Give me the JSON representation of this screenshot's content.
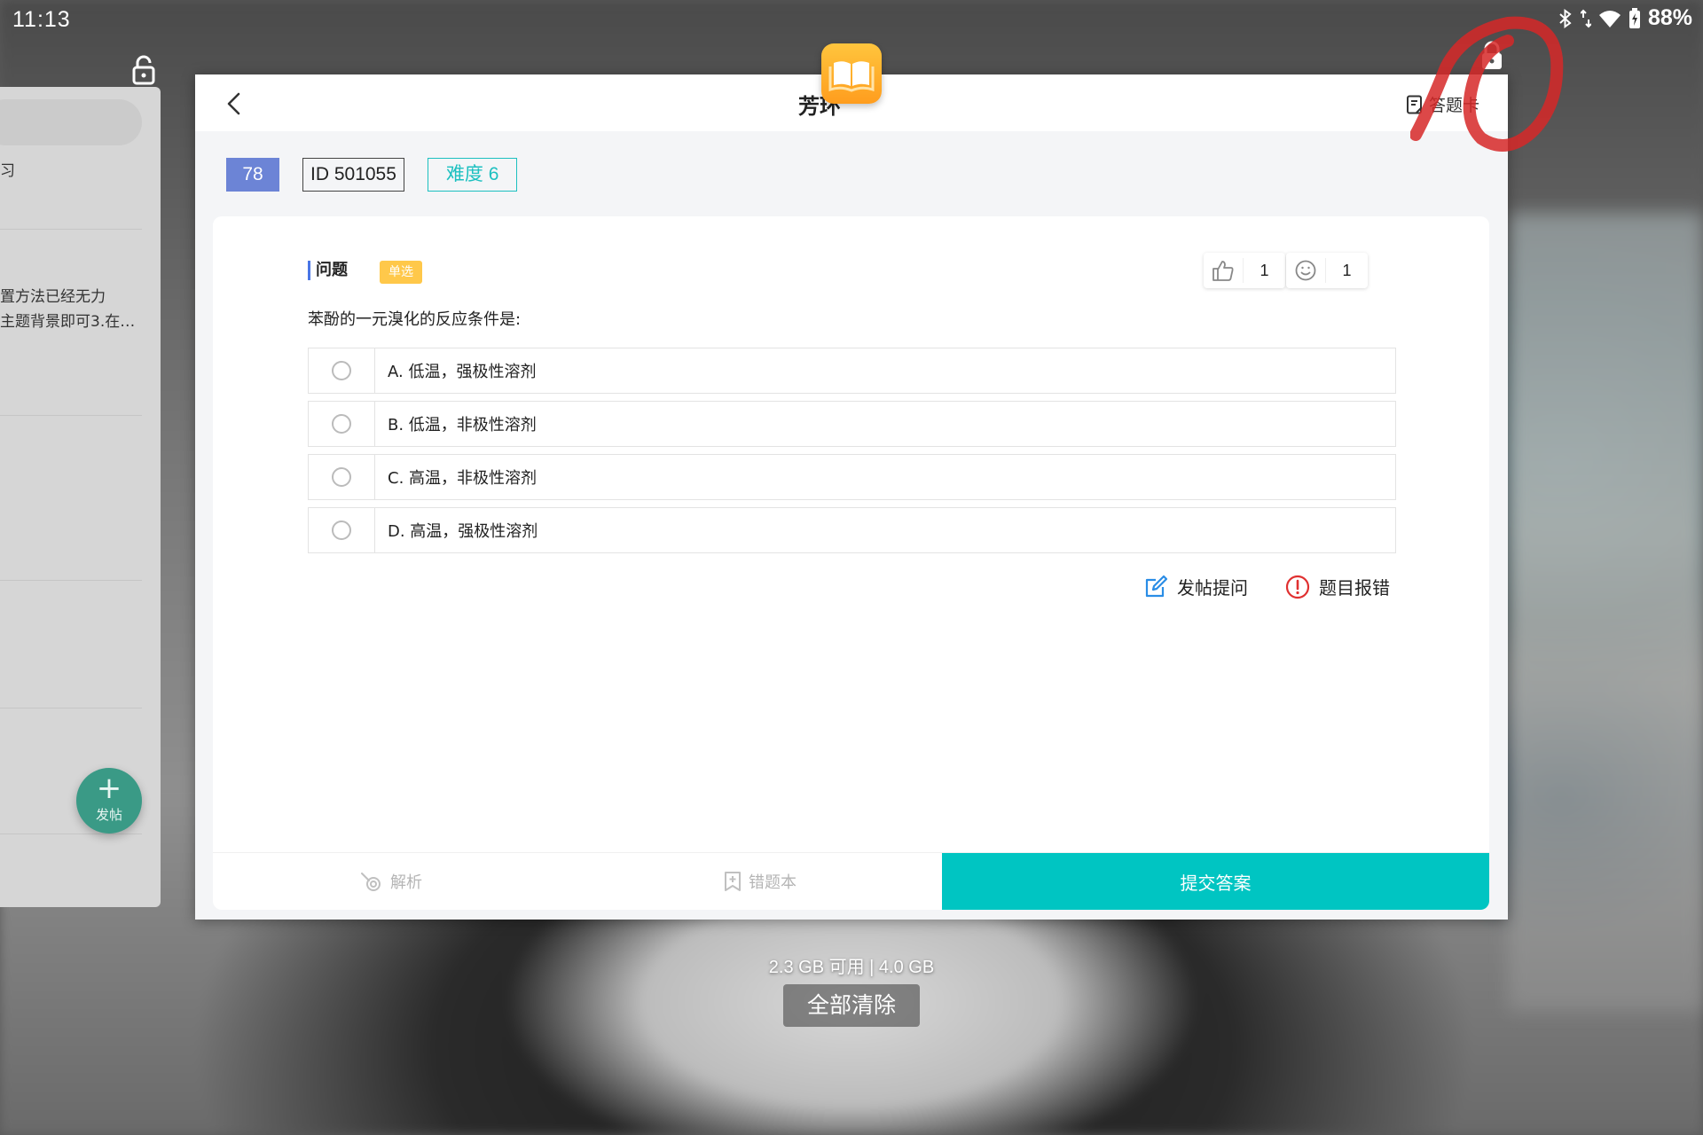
{
  "status_bar": {
    "time": "11:13",
    "battery": "88%",
    "icons": [
      "bluetooth-icon",
      "data-arrows-icon",
      "wifi-icon",
      "battery-icon"
    ]
  },
  "left_card": {
    "text_1": "习",
    "text_2": "置方法已经无力",
    "text_3": "主题背景即可3.在…",
    "fab_label": "发帖"
  },
  "header": {
    "title": "芳环",
    "answer_card": "答题卡"
  },
  "tags": {
    "number": "78",
    "id": "ID 501055",
    "difficulty": "难度 6"
  },
  "question": {
    "label": "问题",
    "type": "单选",
    "stem": "苯酚的一元溴化的反应条件是:",
    "likes": "1",
    "reactions": "1",
    "options": [
      "A. 低温，强极性溶剂",
      "B. 低温，非极性溶剂",
      "C. 高温，非极性溶剂",
      "D. 高温，强极性溶剂"
    ]
  },
  "actions": {
    "post": "发帖提问",
    "report": "题目报错"
  },
  "bottom_bar": {
    "analysis": "解析",
    "mistakes": "错题本",
    "submit": "提交答案"
  },
  "recents": {
    "memory": "2.3 GB 可用 | 4.0 GB",
    "clear_all": "全部清除"
  },
  "colors": {
    "accent_teal": "#00c5c2",
    "tag_blue": "#6c84d6",
    "badge_yellow": "#ffc84a",
    "report_red": "#e03030",
    "post_blue": "#2a8de6"
  }
}
